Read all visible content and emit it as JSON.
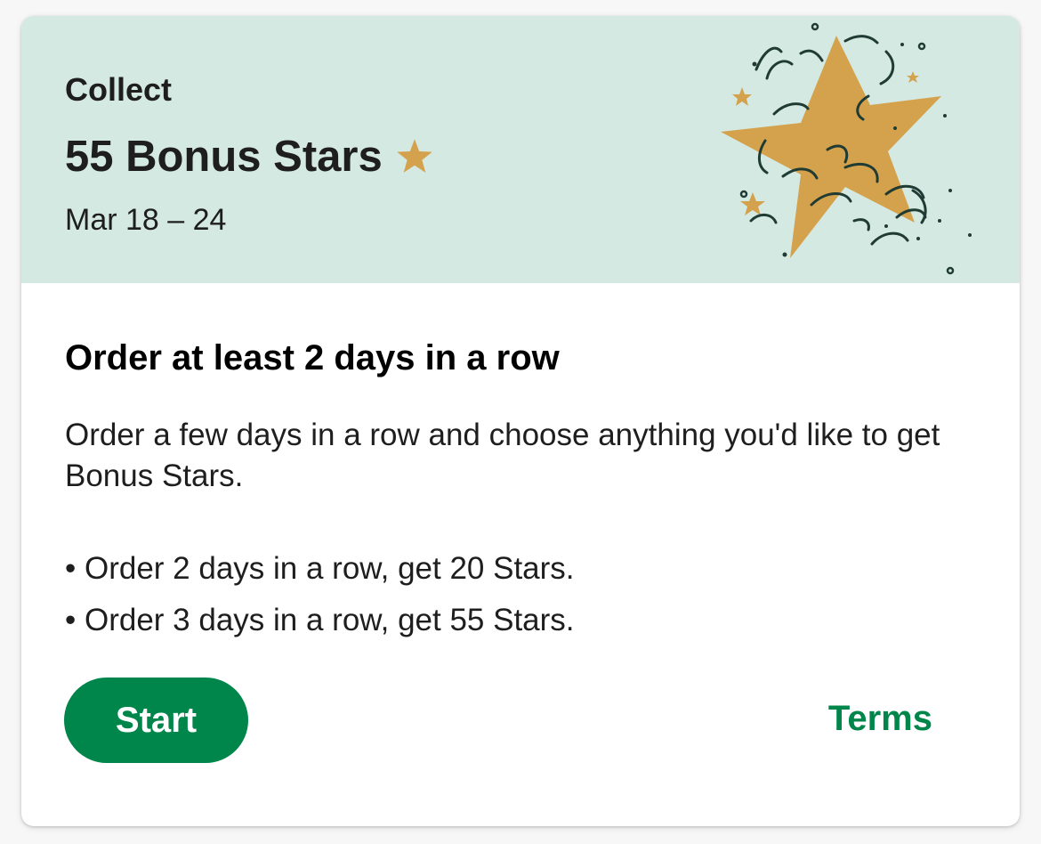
{
  "offer": {
    "eyebrow": "Collect",
    "headline": "55 Bonus Stars",
    "dates": "Mar 18 – 24",
    "title": "Order at least 2 days in a row",
    "description": "Order a few days in a row and choose anything you'd like to get Bonus Stars.",
    "rules": [
      "• Order 2 days in a row, get 20 Stars.",
      "• Order 3 days in a row, get 55 Stars."
    ],
    "start_label": "Start",
    "terms_label": "Terms"
  },
  "icons": {
    "headline_star": "star-icon",
    "illustration": "star-illustration"
  },
  "colors": {
    "banner_bg": "#d4e9e2",
    "star_gold": "#d4a24c",
    "button_green": "#00864a",
    "text": "#1e1e1e"
  }
}
